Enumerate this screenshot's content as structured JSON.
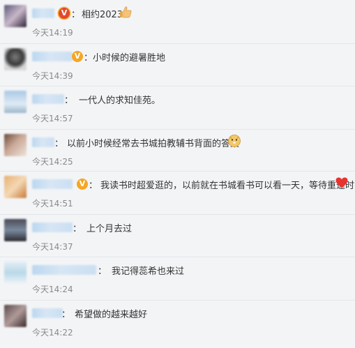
{
  "comments": [
    {
      "text": "相约2023",
      "time": "今天14:19",
      "badge": "v-red",
      "emoji": "thumbs-up-icon"
    },
    {
      "text": "小时候的避暑胜地",
      "time": "今天14:39",
      "badge": "v-orange"
    },
    {
      "text": "一代人的求知佳苑。",
      "time": "今天14:57"
    },
    {
      "text": "以前小时候经常去书城拍教辅书背面的答案",
      "time": "今天14:25",
      "emoji": "doge-icon"
    },
    {
      "text": "我读书时超爱逛的，以前就在书城看书可以看一天，等待重逢时",
      "time": "今天14:51",
      "badge": "v-orange",
      "emoji": "heart-icon"
    },
    {
      "text": "上个月去过",
      "time": "今天14:37"
    },
    {
      "text": "我记得蕊希也来过",
      "time": "今天14:24"
    },
    {
      "text": "希望做的越来越好",
      "time": "今天14:22"
    }
  ],
  "colon": "：",
  "badge_label": "V",
  "colors": {
    "time": "#8a8a8a",
    "text": "#333333",
    "name_blur": "#c9def2",
    "badge_orange": "#f5a623",
    "badge_red": "#e24a2e",
    "heart": "#e8332f"
  }
}
